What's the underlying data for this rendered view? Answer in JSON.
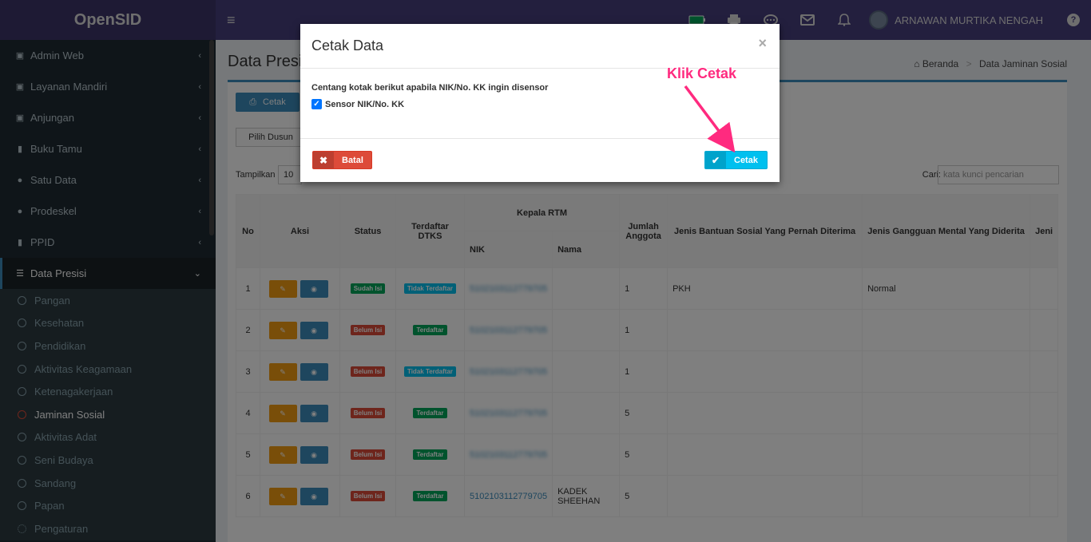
{
  "app": {
    "brand": "OpenSID"
  },
  "topbar": {
    "menu_icon": "bars-icon",
    "user_name": "ARNAWAN MURTIKA NENGAH",
    "help": "?"
  },
  "sidebar": {
    "items": [
      {
        "label": "Admin Web",
        "icon": "monitor-icon"
      },
      {
        "label": "Layanan Mandiri",
        "icon": "laptop-icon"
      },
      {
        "label": "Anjungan",
        "icon": "monitor-icon"
      },
      {
        "label": "Buku Tamu",
        "icon": "book-icon"
      },
      {
        "label": "Satu Data",
        "icon": "globe-icon"
      },
      {
        "label": "Prodeskel",
        "icon": "globe-icon"
      },
      {
        "label": "PPID",
        "icon": "book-icon"
      },
      {
        "label": "Data Presisi",
        "icon": "database-icon"
      }
    ],
    "sub_items": [
      "Pangan",
      "Kesehatan",
      "Pendidikan",
      "Aktivitas Keagamaan",
      "Ketenagakerjaan",
      "Jaminan Sosial",
      "Aktivitas Adat",
      "Seni Budaya",
      "Sandang",
      "Papan",
      "Pengaturan"
    ]
  },
  "page": {
    "title": "Data Presisi",
    "breadcrumb_home": "Beranda",
    "breadcrumb_current": "Data Jaminan Sosial",
    "cetak_button": "Cetak",
    "pilih_dusun": "Pilih Dusun",
    "show_label": "Tampilkan",
    "show_value": "10",
    "search_label": "Cari:",
    "search_placeholder": "kata kunci pencarian"
  },
  "table": {
    "headers": {
      "no": "No",
      "aksi": "Aksi",
      "status": "Status",
      "dtks": "Terdaftar DTKS",
      "kepala": "Kepala RTM",
      "nik": "NIK",
      "nama": "Nama",
      "jumlah": "Jumlah Anggota",
      "bantuan": "Jenis Bantuan Sosial Yang Pernah Diterima",
      "gangguan": "Jenis Gangguan Mental Yang Diderita",
      "extra": "Jeni"
    },
    "rows": [
      {
        "no": "1",
        "status": "Sudah Isi",
        "dtks": "Tidak Terdaftar",
        "nik": "5102103112779705",
        "nama": "",
        "jumlah": "1",
        "bantuan": "PKH",
        "gangguan": "Normal"
      },
      {
        "no": "2",
        "status": "Belum Isi",
        "dtks": "Terdaftar",
        "nik": "5102103112779705",
        "nama": "",
        "jumlah": "1",
        "bantuan": "",
        "gangguan": ""
      },
      {
        "no": "3",
        "status": "Belum Isi",
        "dtks": "Tidak Terdaftar",
        "nik": "5102103112779705",
        "nama": "",
        "jumlah": "1",
        "bantuan": "",
        "gangguan": ""
      },
      {
        "no": "4",
        "status": "Belum Isi",
        "dtks": "Terdaftar",
        "nik": "5102103112779705",
        "nama": "",
        "jumlah": "5",
        "bantuan": "",
        "gangguan": ""
      },
      {
        "no": "5",
        "status": "Belum Isi",
        "dtks": "Terdaftar",
        "nik": "5102103112779705",
        "nama": "",
        "jumlah": "5",
        "bantuan": "",
        "gangguan": ""
      },
      {
        "no": "6",
        "status": "Belum Isi",
        "dtks": "Terdaftar",
        "nik": "5102103112779705",
        "nama": "KADEK SHEEHAN",
        "jumlah": "5",
        "bantuan": "",
        "gangguan": ""
      }
    ]
  },
  "modal": {
    "title": "Cetak Data",
    "close": "×",
    "instruction": "Centang kotak berikut apabila NIK/No. KK ingin disensor",
    "checkbox_label": "Sensor NIK/No. KK",
    "checkbox_checked": true,
    "batal": "Batal",
    "cetak": "Cetak"
  },
  "annotation": {
    "text": "Klik Cetak",
    "color": "#ff2a7f"
  }
}
